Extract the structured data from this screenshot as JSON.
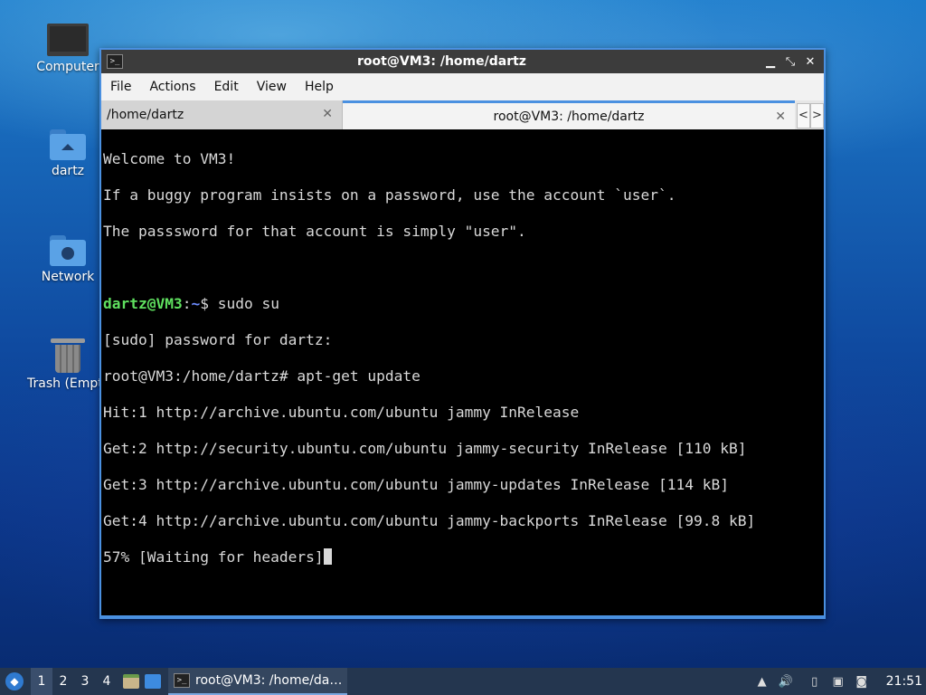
{
  "desktop": {
    "icons": [
      {
        "label": "Computer",
        "icon": "computer-icon"
      },
      {
        "label": "dartz",
        "icon": "home-folder-icon"
      },
      {
        "label": "Network",
        "icon": "network-folder-icon"
      },
      {
        "label": "Trash (Empty)",
        "icon": "trash-icon"
      }
    ]
  },
  "window": {
    "title": "root@VM3: /home/dartz",
    "title_icon": ">_",
    "controls": {
      "minimize": "▁",
      "maximize": "⤡",
      "close": "✕"
    },
    "menu": [
      "File",
      "Actions",
      "Edit",
      "View",
      "Help"
    ],
    "tabs": [
      {
        "label": "/home/dartz",
        "active": false
      },
      {
        "label": "root@VM3: /home/dartz",
        "active": true
      }
    ],
    "tab_nav": {
      "prev": "<",
      "next": ">"
    },
    "tab_close_glyph": "✕"
  },
  "terminal": {
    "welcome": [
      "Welcome to VM3!",
      "If a buggy program insists on a password, use the account `user`.",
      "The passsword for that account is simply \"user\"."
    ],
    "prompt": {
      "user": "dartz@VM3",
      "sep": ":",
      "path": "~",
      "sym": "$ ",
      "command": "sudo su"
    },
    "output": [
      "[sudo] password for dartz:",
      "root@VM3:/home/dartz# apt-get update",
      "Hit:1 http://archive.ubuntu.com/ubuntu jammy InRelease",
      "Get:2 http://security.ubuntu.com/ubuntu jammy-security InRelease [110 kB]",
      "Get:3 http://archive.ubuntu.com/ubuntu jammy-updates InRelease [114 kB]",
      "Get:4 http://archive.ubuntu.com/ubuntu jammy-backports InRelease [99.8 kB]"
    ],
    "progress_line": "57% [Waiting for headers]"
  },
  "taskbar": {
    "start_icon": "start-menu-icon",
    "workspaces": [
      "1",
      "2",
      "3",
      "4"
    ],
    "active_workspace": "1",
    "task": {
      "label": "root@VM3: /home/da…",
      "icon": ">_"
    },
    "clock": "21:51",
    "tray_icons": [
      "updates-icon",
      "volume-icon",
      "clipboard-icon",
      "network-icon",
      "notification-icon"
    ]
  }
}
